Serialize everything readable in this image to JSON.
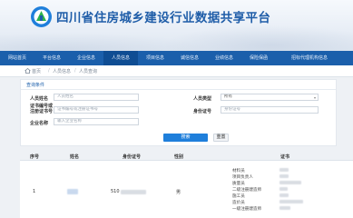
{
  "header": {
    "site_title": "四川省住房城乡建设行业数据共享平台"
  },
  "nav": {
    "items": [
      "网站首页",
      "平台信息",
      "企业信息",
      "人员信息",
      "项目信息",
      "诚信信息",
      "业绩信息",
      "保险保函",
      "招标代理机构信息"
    ],
    "active_index": 3
  },
  "breadcrumb": {
    "items": [
      "首页",
      "人员信息",
      "人员查询"
    ]
  },
  "search": {
    "panel_title": "查询条件",
    "name_label": "人员姓名",
    "name_placeholder": "人员姓名",
    "type_label": "人员类型",
    "type_value": "所有",
    "cert_label_line1": "证书编号或",
    "cert_label_line2": "注册证书号",
    "cert_placeholder": "证书编号或注册证书号",
    "id_label": "身份证号",
    "id_placeholder": "身份证号",
    "company_label": "企业名称",
    "company_placeholder": "输入企业名称",
    "search_button": "搜索",
    "reset_button": "重置"
  },
  "table": {
    "headers": [
      "序号",
      "姓名",
      "身份证号",
      "性别",
      "证书"
    ],
    "rows": [
      {
        "index": "1",
        "id_prefix": "510",
        "gender": "男",
        "cert_types": [
          "材料员",
          "项目负责人",
          "质量员",
          "二级注册建造师",
          "施工员",
          "造价员",
          "一级注册建造师"
        ]
      }
    ]
  },
  "colors": {
    "nav_bg": "#1b5fab",
    "title_color": "#1f5da8",
    "primary_button": "#1f7fdb"
  }
}
